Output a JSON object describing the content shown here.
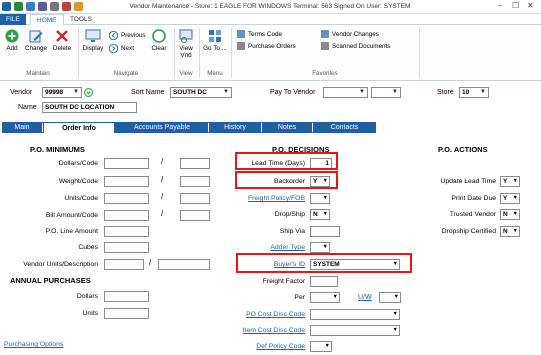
{
  "window": {
    "title": "Vendor Maintenance - Store: 1 EAGLE FOR WINDOWS Terminal: 563 Signed On User: SYSTEM",
    "minimize": "–",
    "maximize": "☐",
    "close": "✕"
  },
  "ribbon_tabs": [
    "FILE",
    "HOME",
    "TOOLS"
  ],
  "ribbon": {
    "maintain": {
      "label": "Maintain",
      "add": "Add",
      "change": "Change",
      "delete": "Delete"
    },
    "navigate": {
      "label": "Navigate",
      "display": "Display",
      "previous": "Previous",
      "next": "Next",
      "clear": "Clear"
    },
    "view": {
      "label": "View",
      "view_vnd": "View Vnd"
    },
    "menu": {
      "label": "Menu",
      "go_to": "Go To ..."
    },
    "favorites": {
      "label": "Favorites",
      "terms_code": "Terms Code",
      "purchase_orders": "Purchase Orders",
      "vendor_changes": "Vendor Changes",
      "scanned_documents": "Scanned Documents"
    }
  },
  "header": {
    "vendor_label": "Vendor",
    "vendor_value": "99998",
    "sort_name_label": "Sort Name",
    "sort_name_value": "SOUTH DC",
    "pay_to_vendor_label": "Pay To Vendor",
    "pay_to_vendor_value": "",
    "store_label": "Store",
    "store_value": "10",
    "name_label": "Name",
    "name_value": "SOUTH DC LOCATION"
  },
  "form_tabs": [
    "Main",
    "Order Info",
    "Accounts Payable",
    "History",
    "Notes",
    "Contacts"
  ],
  "active_tab": "Order Info",
  "po_minimums": {
    "heading": "P.O. MINIMUMS",
    "dollars_code": "Dollars/Code",
    "weight_code": "Weight/Code",
    "units_code": "Units/Code",
    "bill_amount_code": "Bill Amount/Code",
    "po_line_amount": "P.O. Line Amount",
    "cubes": "Cubes",
    "vendor_units_description": "Vendor Units/Description",
    "slash": "/"
  },
  "annual_purchases": {
    "heading": "ANNUAL PURCHASES",
    "dollars": "Dollars",
    "units": "Units"
  },
  "purchasing_options": "Purchasing Options",
  "po_decisions": {
    "heading": "P.O. DECISIONS",
    "lead_time_days_label": "Lead Time (Days)",
    "lead_time_days_value": "1",
    "backorder_label": "Backorder",
    "backorder_value": "Y",
    "freight_policy_fob": "Freight Policy/FOB",
    "drop_ship_label": "Drop/Ship",
    "drop_ship_value": "N",
    "ship_via": "Ship Via",
    "adder_type": "Adder Type",
    "buyers_id_label": "Buyer's ID",
    "buyers_id_value": "SYSTEM",
    "freight_factor": "Freight Factor",
    "per": "Per",
    "uw": "U/W",
    "po_cost_disc_code": "PO Cost Disc Code",
    "item_cost_disc_code": "Item Cost Disc Code",
    "def_policy_code": "Def Policy Code"
  },
  "po_actions": {
    "heading": "P.O. ACTIONS",
    "update_lead_time_label": "Update Lead Time",
    "update_lead_time_value": "Y",
    "print_date_due_label": "Print Date Due",
    "print_date_due_value": "Y",
    "trusted_vendor_label": "Trusted Vendor",
    "trusted_vendor_value": "N",
    "dropship_certified_label": "Dropship Certified",
    "dropship_certified_value": "N"
  },
  "colors": {
    "accent": "#1f5fa8",
    "highlight": "#e8141b"
  }
}
